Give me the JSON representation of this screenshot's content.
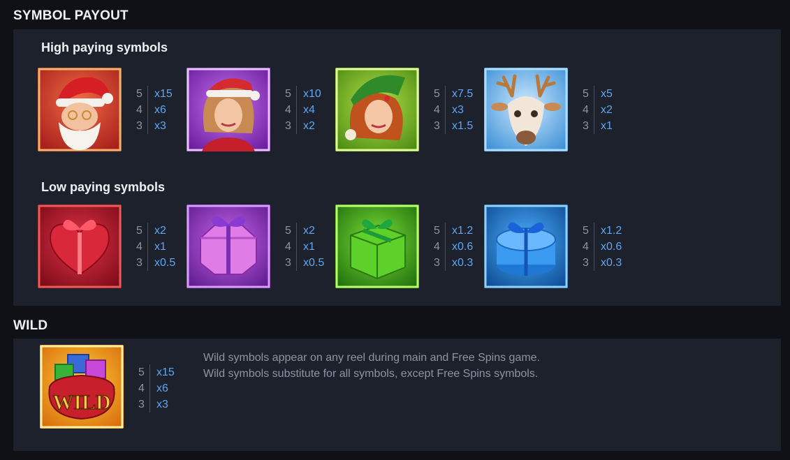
{
  "symbol_payout": {
    "title": "SYMBOL PAYOUT",
    "high": {
      "title": "High paying symbols",
      "symbols": [
        {
          "icon": "santa-claus-symbol-icon",
          "color": "#d8423a",
          "pays": [
            {
              "count": "5",
              "mult": "x15"
            },
            {
              "count": "4",
              "mult": "x6"
            },
            {
              "count": "3",
              "mult": "x3"
            }
          ]
        },
        {
          "icon": "mrs-claus-symbol-icon",
          "color": "#9a35c8",
          "pays": [
            {
              "count": "5",
              "mult": "x10"
            },
            {
              "count": "4",
              "mult": "x4"
            },
            {
              "count": "3",
              "mult": "x2"
            }
          ]
        },
        {
          "icon": "elf-girl-symbol-icon",
          "color": "#6fb523",
          "pays": [
            {
              "count": "5",
              "mult": "x7.5"
            },
            {
              "count": "4",
              "mult": "x3"
            },
            {
              "count": "3",
              "mult": "x1.5"
            }
          ]
        },
        {
          "icon": "reindeer-symbol-icon",
          "color": "#4aa8e8",
          "pays": [
            {
              "count": "5",
              "mult": "x5"
            },
            {
              "count": "4",
              "mult": "x2"
            },
            {
              "count": "3",
              "mult": "x1"
            }
          ]
        }
      ]
    },
    "low": {
      "title": "Low paying symbols",
      "symbols": [
        {
          "icon": "red-heart-gift-icon",
          "color": "#c8202c",
          "pays": [
            {
              "count": "5",
              "mult": "x2"
            },
            {
              "count": "4",
              "mult": "x1"
            },
            {
              "count": "3",
              "mult": "x0.5"
            }
          ]
        },
        {
          "icon": "purple-hexagon-gift-icon",
          "color": "#9b3fd0",
          "pays": [
            {
              "count": "5",
              "mult": "x2"
            },
            {
              "count": "4",
              "mult": "x1"
            },
            {
              "count": "3",
              "mult": "x0.5"
            }
          ]
        },
        {
          "icon": "green-box-gift-icon",
          "color": "#3fae1c",
          "pays": [
            {
              "count": "5",
              "mult": "x1.2"
            },
            {
              "count": "4",
              "mult": "x0.6"
            },
            {
              "count": "3",
              "mult": "x0.3"
            }
          ]
        },
        {
          "icon": "blue-round-gift-icon",
          "color": "#1f86d8",
          "pays": [
            {
              "count": "5",
              "mult": "x1.2"
            },
            {
              "count": "4",
              "mult": "x0.6"
            },
            {
              "count": "3",
              "mult": "x0.3"
            }
          ]
        }
      ]
    }
  },
  "wild": {
    "title": "WILD",
    "symbol_label": "WILD",
    "icon": "wild-gift-sack-icon",
    "pays": [
      {
        "count": "5",
        "mult": "x15"
      },
      {
        "count": "4",
        "mult": "x6"
      },
      {
        "count": "3",
        "mult": "x3"
      }
    ],
    "description": [
      "Wild symbols appear on any reel during main and Free Spins game.",
      "Wild symbols substitute for all symbols, except Free Spins symbols."
    ]
  }
}
